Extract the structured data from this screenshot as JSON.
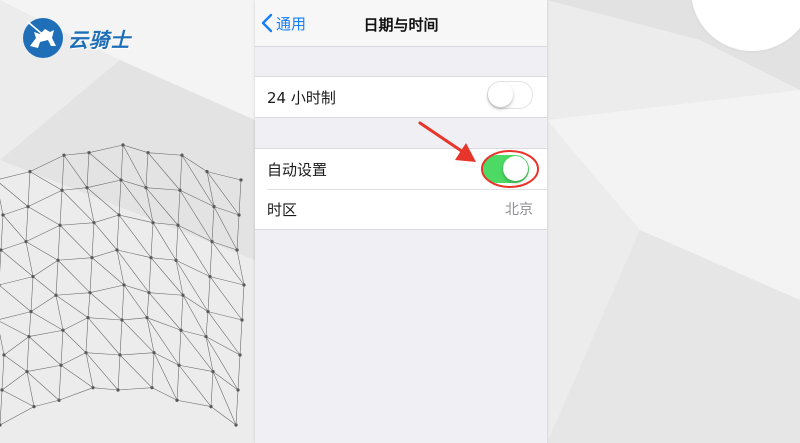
{
  "watermark": {
    "brand_text": "云骑士",
    "logo_icon": "knight-on-horse-icon",
    "brand_color": "#1f6fb8"
  },
  "nav": {
    "back_label": "通用",
    "back_icon": "chevron-left-icon",
    "title": "日期与时间"
  },
  "settings": {
    "hour24": {
      "label": "24 小时制",
      "enabled": false
    },
    "auto_set": {
      "label": "自动设置",
      "enabled": true
    },
    "timezone": {
      "label": "时区",
      "value": "北京"
    }
  },
  "annotation": {
    "arrow_icon": "red-arrow-icon",
    "highlight": "red-circle-highlight",
    "color": "#e8352b"
  },
  "colors": {
    "ios_blue": "#157efb",
    "toggle_on": "#4cd964",
    "group_bg": "#efeff4"
  }
}
